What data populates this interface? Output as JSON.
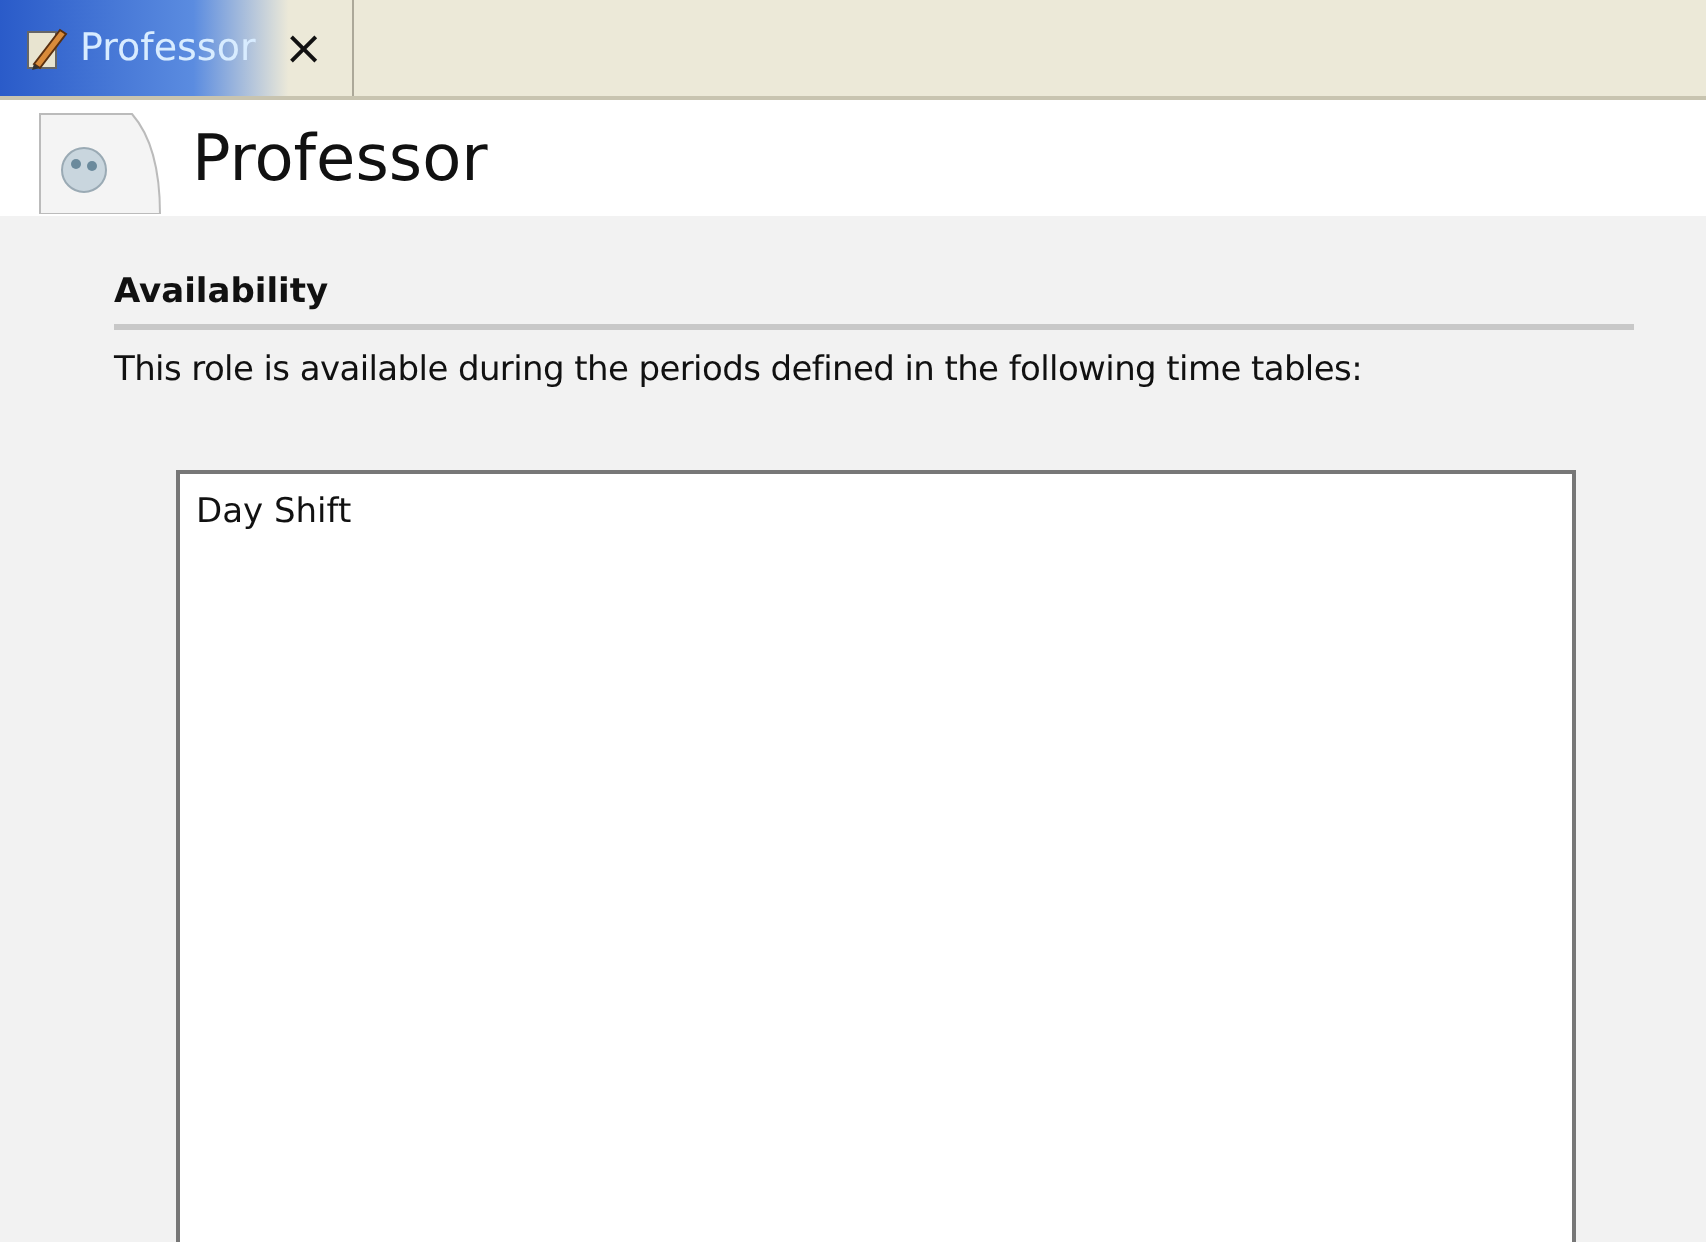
{
  "tabs": [
    {
      "label": "Professor",
      "close": "×",
      "selected": true
    }
  ],
  "header": {
    "title": "Professor"
  },
  "section": {
    "heading": "Availability",
    "description": "This role is available during the periods defined in the following time tables:"
  },
  "time_tables": [
    {
      "label": "Day Shift",
      "selected": false
    }
  ]
}
